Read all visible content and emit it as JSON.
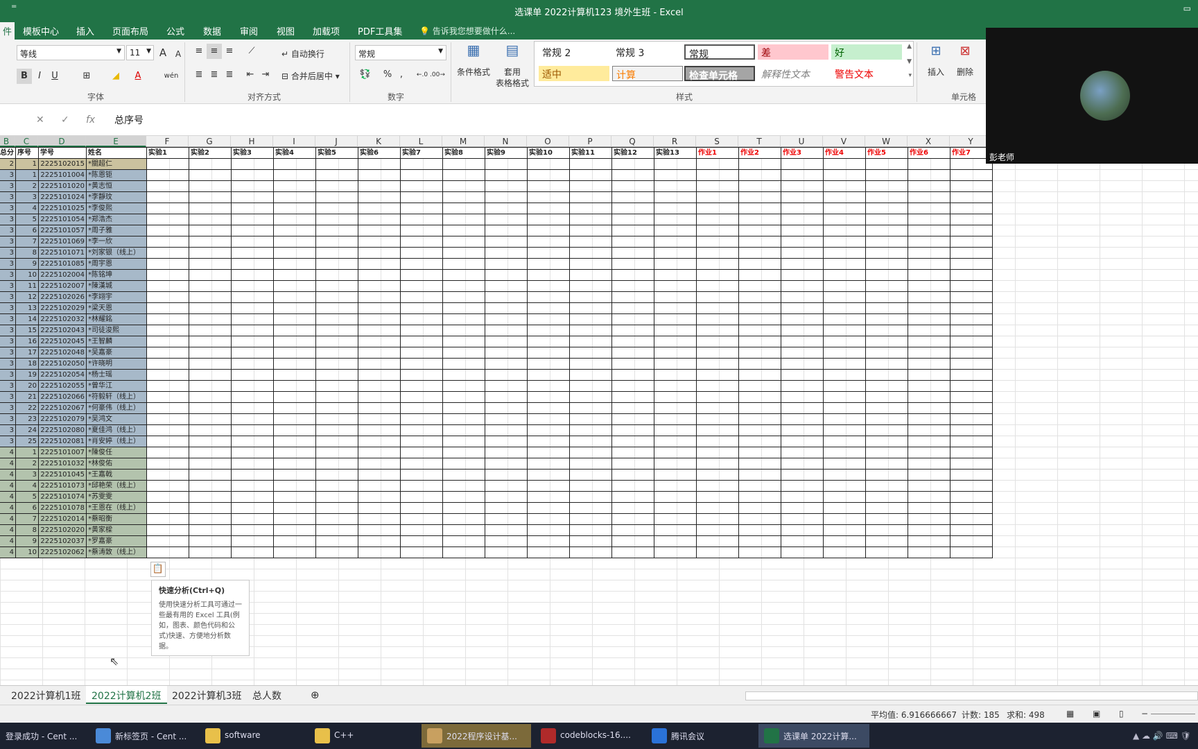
{
  "window": {
    "title": "选课单 2022计算机123 境外生班 - Excel",
    "qat": "="
  },
  "ribbon_tabs": [
    "件",
    "模板中心",
    "插入",
    "页面布局",
    "公式",
    "数据",
    "审阅",
    "视图",
    "加载项",
    "PDF工具集"
  ],
  "tell_me": "告诉我您想要做什么...",
  "font": {
    "name": "等线",
    "size": "11",
    "group_label": "字体",
    "bold": "B",
    "italic": "I",
    "underline": "U",
    "grow": "A",
    "shrink": "A",
    "color": "A",
    "wen": "wén"
  },
  "alignment": {
    "wrap": "自动换行",
    "merge": "合并后居中",
    "group_label": "对齐方式"
  },
  "number": {
    "format": "常规",
    "percent": "%",
    "comma": ",",
    "group_label": "数字"
  },
  "styles": {
    "cond_format": "条件格式",
    "table_format_1": "套用",
    "table_format_2": "表格格式",
    "cells": [
      "常规 2",
      "常规 3",
      "常规",
      "差",
      "好",
      "适中",
      "计算",
      "检查单元格",
      "解释性文本",
      "警告文本"
    ],
    "group_label": "样式"
  },
  "cells_group": {
    "insert": "插入",
    "delete": "删除",
    "group_label": "单元格"
  },
  "formula_bar": {
    "content": "总序号",
    "fx": "fx"
  },
  "columns": [
    "B",
    "C",
    "D",
    "E",
    "F",
    "G",
    "H",
    "I",
    "J",
    "K",
    "L",
    "M",
    "N",
    "O",
    "P",
    "Q",
    "R",
    "S",
    "T",
    "U",
    "V",
    "W",
    "X",
    "Y"
  ],
  "header_row": [
    "总分",
    "序号",
    "学号",
    "姓名",
    "实验1",
    "实验2",
    "实验3",
    "实验4",
    "实验5",
    "实验6",
    "实验7",
    "实验8",
    "实验9",
    "实验10",
    "实验11",
    "实验12",
    "实验13",
    "作业1",
    "作业2",
    "作业3",
    "作业4",
    "作业5",
    "作业6",
    "作业7"
  ],
  "rows": [
    [
      "2",
      "1",
      "2225102015",
      "*關超仁"
    ],
    [
      "3",
      "1",
      "2225101004",
      "*陈恩钜"
    ],
    [
      "3",
      "2",
      "2225101020",
      "*黄志恒"
    ],
    [
      "3",
      "3",
      "2225101024",
      "*李靜玟"
    ],
    [
      "3",
      "4",
      "2225101025",
      "*李俊煕"
    ],
    [
      "3",
      "5",
      "2225101054",
      "*郑浩杰"
    ],
    [
      "3",
      "6",
      "2225101057",
      "*周子雅"
    ],
    [
      "3",
      "7",
      "2225101069",
      "*李一欣"
    ],
    [
      "3",
      "8",
      "2225101071",
      "*刘家银（线上）"
    ],
    [
      "3",
      "9",
      "2225101085",
      "*周宇恩"
    ],
    [
      "3",
      "10",
      "2225102004",
      "*陈铭坤"
    ],
    [
      "3",
      "11",
      "2225102007",
      "*陳漢城"
    ],
    [
      "3",
      "12",
      "2225102026",
      "*李翊宇"
    ],
    [
      "3",
      "13",
      "2225102029",
      "*梁天恩"
    ],
    [
      "3",
      "14",
      "2225102032",
      "*林耀銘"
    ],
    [
      "3",
      "15",
      "2225102043",
      "*司徒浚熙"
    ],
    [
      "3",
      "16",
      "2225102045",
      "*王智麟"
    ],
    [
      "3",
      "17",
      "2225102048",
      "*吴嘉豪"
    ],
    [
      "3",
      "18",
      "2225102050",
      "*许晓明"
    ],
    [
      "3",
      "19",
      "2225102054",
      "*杨士瑶"
    ],
    [
      "3",
      "20",
      "2225102055",
      "*曾华江"
    ],
    [
      "3",
      "21",
      "2225102066",
      "*符毅轩（线上）"
    ],
    [
      "3",
      "22",
      "2225102067",
      "*何豪伟（线上）"
    ],
    [
      "3",
      "23",
      "2225102079",
      "*吴鸿文"
    ],
    [
      "3",
      "24",
      "2225102080",
      "*夏佳鸿（线上）"
    ],
    [
      "3",
      "25",
      "2225102081",
      "*肖安婷（线上）"
    ],
    [
      "4",
      "1",
      "2225101007",
      "*陳俊任"
    ],
    [
      "4",
      "2",
      "2225101032",
      "*林俊佑"
    ],
    [
      "4",
      "3",
      "2225101045",
      "*王嘉戟"
    ],
    [
      "4",
      "4",
      "2225101073",
      "*邱艳荣（线上）"
    ],
    [
      "4",
      "5",
      "2225101074",
      "*苏雯雯"
    ],
    [
      "4",
      "6",
      "2225101078",
      "*王恩在（线上）"
    ],
    [
      "4",
      "7",
      "2225102014",
      "*蔡昭衡"
    ],
    [
      "4",
      "8",
      "2225102020",
      "*黄家樑"
    ],
    [
      "4",
      "9",
      "2225102037",
      "*罗嘉豪"
    ],
    [
      "4",
      "10",
      "2225102062",
      "*蔡涛致（线上）"
    ]
  ],
  "quick_analysis": {
    "title": "快速分析(Ctrl+Q)",
    "desc": "使用快速分析工具可通过一些最有用的 Excel 工具(例如，图表、颜色代码和公式)快速、方便地分析数据。"
  },
  "sheet_tabs": [
    "2022计算机1班",
    "2022计算机2班",
    "2022计算机3班",
    "总人数"
  ],
  "status": {
    "average": "平均值: 6.916666667",
    "count": "计数: 185",
    "sum": "求和: 498"
  },
  "video": {
    "name": "彭老师"
  },
  "taskbar": [
    "登录成功 - Cent ...",
    "新标签页 - Cent ...",
    "software",
    "C++",
    "2022程序设计基...",
    "codeblocks-16....",
    "腾讯会议",
    "选课单 2022计算..."
  ],
  "colors": {
    "excel_green": "#217346",
    "sel_blue": "#a7b9c9",
    "sel_green": "#b3c3ad",
    "header_red": "#e00000"
  }
}
